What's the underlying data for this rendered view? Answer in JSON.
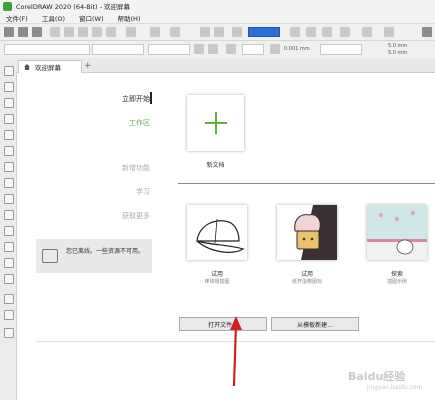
{
  "window": {
    "title": "CorelDRAW 2020 (64-Bit) - 欢迎屏幕"
  },
  "menu": [
    "文件(F)",
    "工具(O)",
    "窗口(W)",
    "帮助(H)"
  ],
  "toolbar": {
    "unit_value": "0.001 mm",
    "size1": "5.0 mm",
    "size2": "5.0 mm"
  },
  "tabs": [
    {
      "label": "欢迎屏幕"
    }
  ],
  "nav": {
    "items": [
      {
        "label": "立即开始",
        "color": "#222222"
      },
      {
        "label": "工作区",
        "color": "#6aa84f"
      },
      {
        "label": "新增功能",
        "color": "#aaaaaa"
      },
      {
        "label": "学习",
        "color": "#aaaaaa"
      },
      {
        "label": "获取更多",
        "color": "#aaaaaa"
      }
    ]
  },
  "offline": {
    "message": "您已离线。一些资源不可用。"
  },
  "new_doc": {
    "label": "新文档"
  },
  "templates": [
    {
      "title": "试用",
      "subtitle": "棒球帽插图",
      "icon": "baseball-cap-icon"
    },
    {
      "title": "试用",
      "subtitle": "纸杯蛋糕图标",
      "icon": "cupcake-icon"
    },
    {
      "title": "探索",
      "subtitle": "插图示例",
      "icon": "cat-illustration-icon"
    }
  ],
  "buttons": {
    "open": "打开文件...",
    "from_template": "从模板新建..."
  },
  "watermark": {
    "text": "Baidu经验",
    "url": "jingyan.baidu.com"
  }
}
